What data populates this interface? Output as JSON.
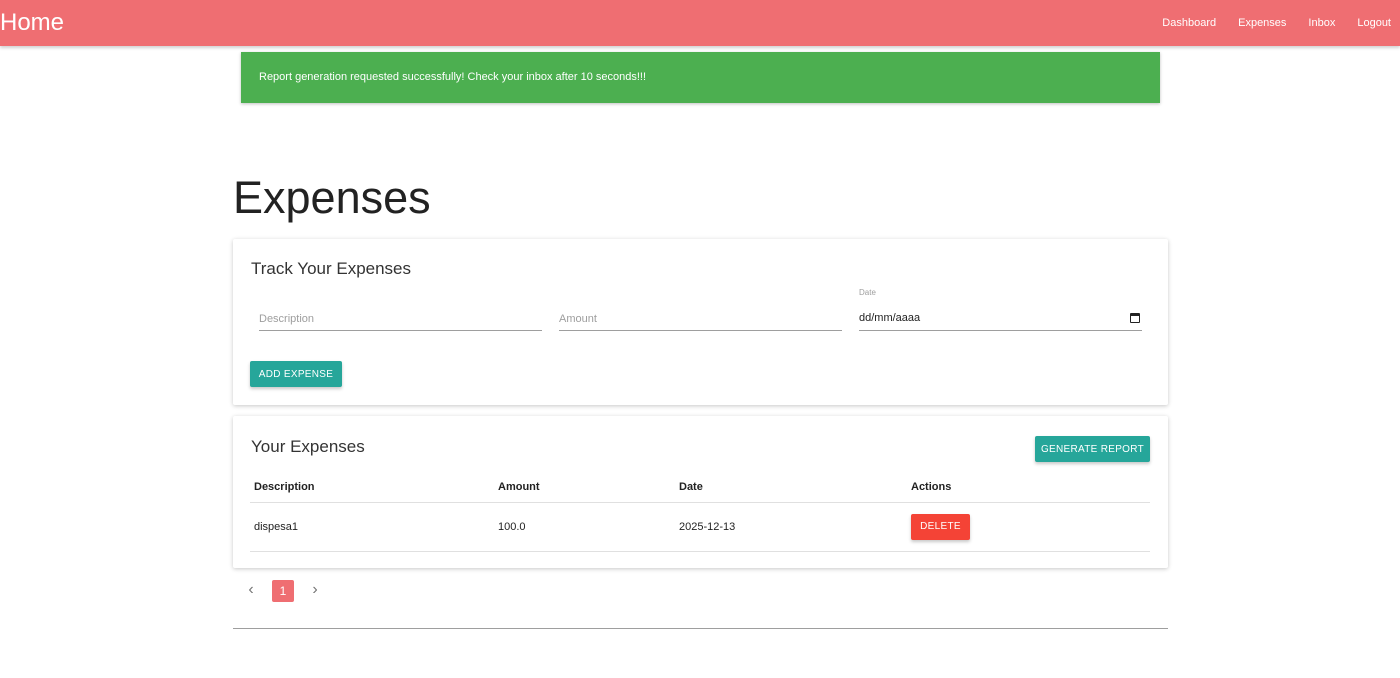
{
  "navbar": {
    "brand": "Home",
    "links": [
      "Dashboard",
      "Expenses",
      "Inbox",
      "Logout"
    ],
    "background": "#ef6e72"
  },
  "alert": {
    "message": "Report generation requested successfully! Check your inbox after 10 seconds!!!",
    "color": "#4caf50"
  },
  "page": {
    "title": "Expenses"
  },
  "form": {
    "title": "Track Your Expenses",
    "description_placeholder": "Description",
    "amount_placeholder": "Amount",
    "date_label": "Date",
    "date_value": "dd/mm/aaaa",
    "add_button": "ADD EXPENSE",
    "accent": "#26a69a"
  },
  "list": {
    "title": "Your Expenses",
    "report_button": "GENERATE REPORT",
    "headers": [
      "Description",
      "Amount",
      "Date",
      "Actions"
    ],
    "rows": [
      {
        "description": "dispesa1",
        "amount": "100.0",
        "date": "2025-12-13",
        "action": "DELETE"
      }
    ]
  },
  "pagination": {
    "prev_icon": "chevron-left-icon",
    "next_icon": "chevron-right-icon",
    "current_page": "1"
  }
}
